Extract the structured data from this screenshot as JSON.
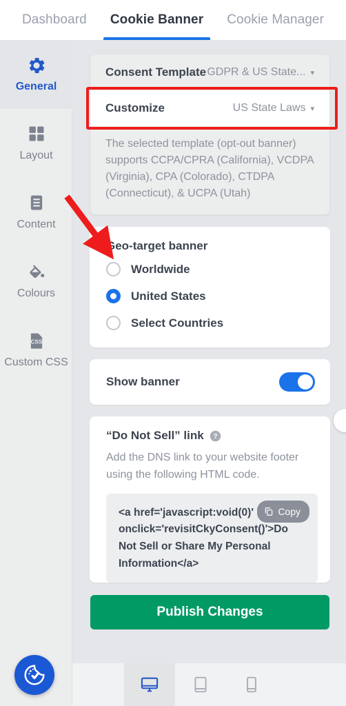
{
  "topbar": {
    "tabs": [
      {
        "label": "Dashboard",
        "active": false
      },
      {
        "label": "Cookie Banner",
        "active": true
      },
      {
        "label": "Cookie Manager",
        "active": false
      }
    ]
  },
  "sidebar": {
    "items": [
      {
        "label": "General",
        "icon": "gear-icon",
        "active": true
      },
      {
        "label": "Layout",
        "icon": "grid-icon",
        "active": false
      },
      {
        "label": "Content",
        "icon": "document-icon",
        "active": false
      },
      {
        "label": "Colours",
        "icon": "paint-bucket-icon",
        "active": false
      },
      {
        "label": "Custom CSS",
        "icon": "css-file-icon",
        "active": false
      }
    ]
  },
  "template_card": {
    "consent_template_label": "Consent Template",
    "consent_template_value": "GDPR & US State...",
    "customize_label": "Customize",
    "customize_value": "US State Laws",
    "description": "The selected template (opt-out banner) supports CCPA/CPRA (California), VCDPA (Virginia), CPA (Colorado), CTDPA (Connecticut), & UCPA (Utah)"
  },
  "geo_card": {
    "title": "Geo-target banner",
    "options": [
      {
        "label": "Worldwide",
        "selected": false
      },
      {
        "label": "United States",
        "selected": true
      },
      {
        "label": "Select Countries",
        "selected": false
      }
    ]
  },
  "show_banner_card": {
    "label": "Show banner",
    "toggle_on": true
  },
  "dns_card": {
    "title": "“Do Not Sell” link",
    "help_icon": "help-circle-icon",
    "description": "Add the DNS link to your website footer using the following HTML code.",
    "code": "<a href='javascript:void(0)' onclick='revisitCkyConsent()'>Do Not Sell or Share My Personal Information</a>",
    "copy_label": "Copy",
    "copy_icon": "copy-icon"
  },
  "publish": {
    "label": "Publish Changes"
  },
  "devicebar": {
    "items": [
      {
        "name": "desktop-icon",
        "active": true
      },
      {
        "name": "tablet-icon",
        "active": false
      },
      {
        "name": "mobile-icon",
        "active": false
      }
    ]
  },
  "widget": {
    "badge_icon": "cookie-check-icon"
  },
  "colors": {
    "accent_blue": "#1a73e8",
    "sidebar_active_text": "#2458c8",
    "publish_green": "#019a65",
    "annotation_red": "#ee1c1c",
    "page_bg": "#e5e6e9",
    "muted_text": "#8d929c"
  }
}
